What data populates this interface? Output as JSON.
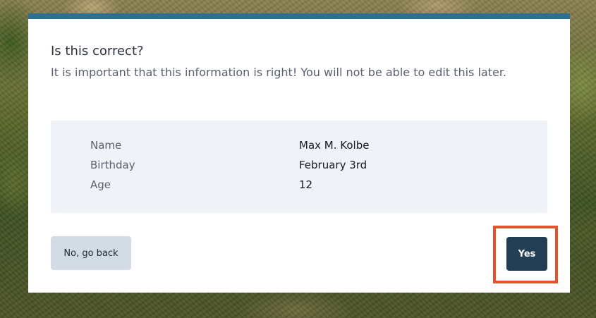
{
  "dialog": {
    "title": "Is this correct?",
    "message": "It is important that this information is right! You will not be able to edit this later.",
    "fields": [
      {
        "label": "Name",
        "value": "Max M. Kolbe"
      },
      {
        "label": "Birthday",
        "value": "February 3rd"
      },
      {
        "label": "Age",
        "value": "12"
      }
    ],
    "back_button_label": "No, go back",
    "confirm_button_label": "Yes"
  },
  "colors": {
    "accent": "#2f6f8f",
    "primary_button": "#213e54",
    "secondary_button": "#d3dbe4",
    "panel": "#eff2f6",
    "highlight": "#e5532c"
  }
}
